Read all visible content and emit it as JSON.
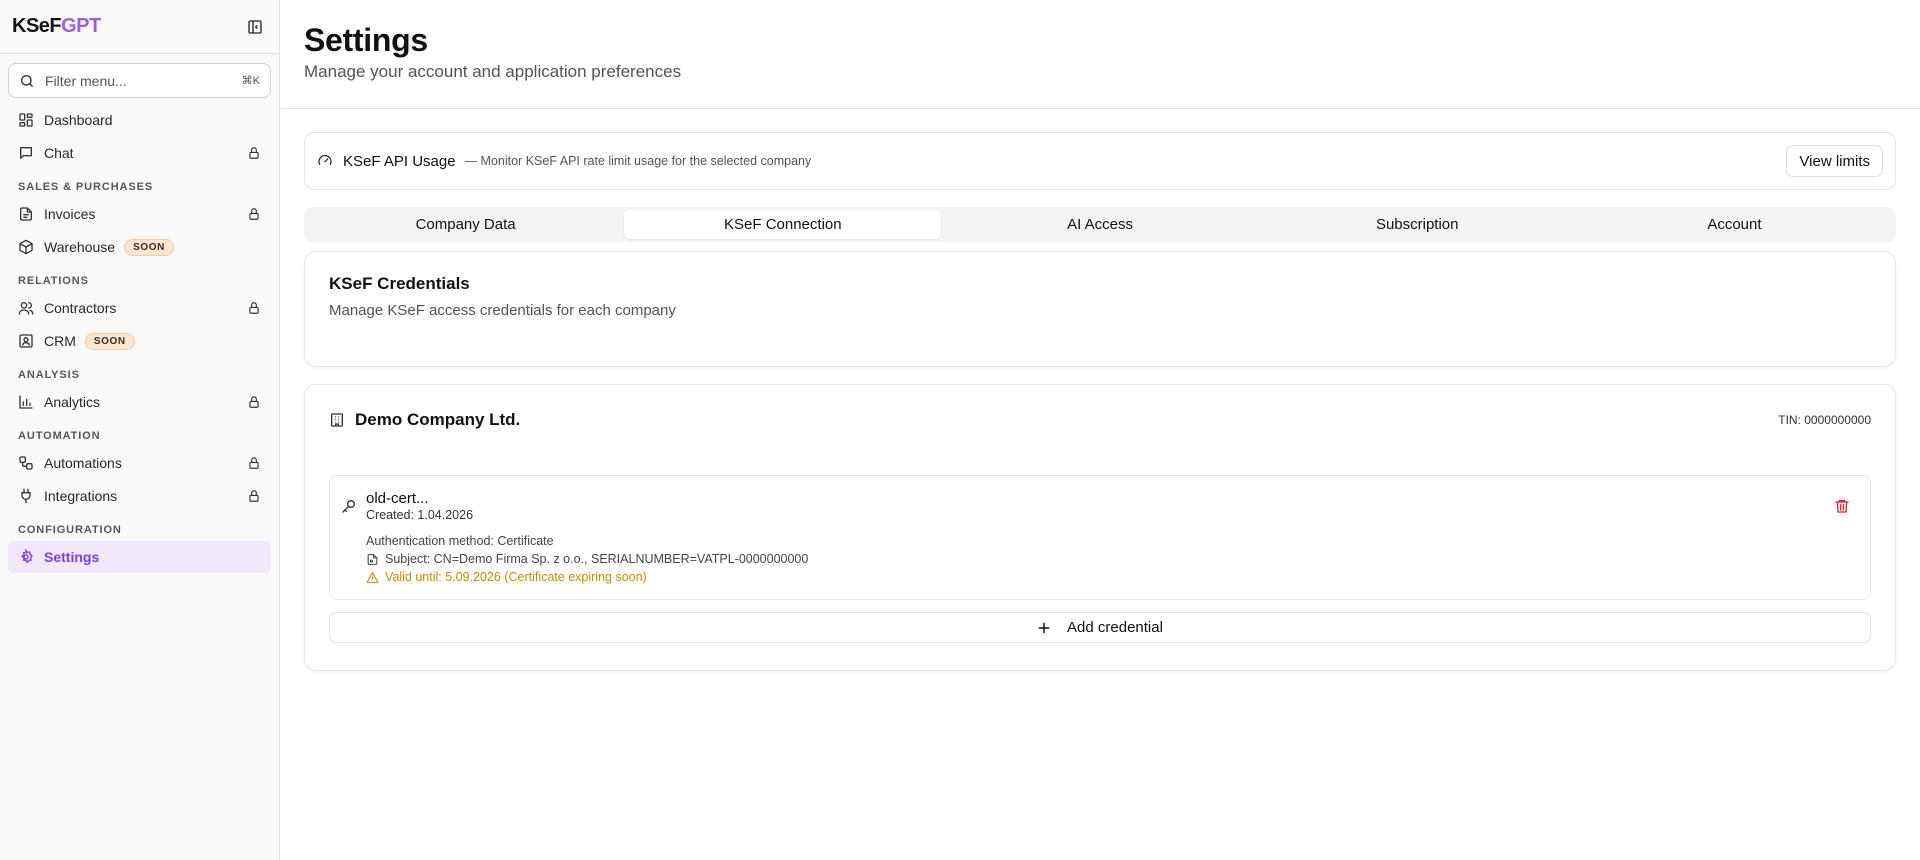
{
  "sidebar": {
    "brand_part1": "KSeF",
    "brand_part2": "GPT",
    "filter_placeholder": "Filter menu...",
    "filter_shortcut": "⌘K",
    "items_top": [
      {
        "label": "Dashboard",
        "icon": "dashboard-icon"
      },
      {
        "label": "Chat",
        "icon": "chat-icon",
        "locked": true
      }
    ],
    "sections": [
      {
        "label": "SALES & PURCHASES"
      },
      {
        "label": "RELATIONS"
      },
      {
        "label": "ANALYSIS"
      },
      {
        "label": "AUTOMATION"
      },
      {
        "label": "CONFIGURATION"
      }
    ],
    "items": {
      "invoices": "Invoices",
      "warehouse": "Warehouse",
      "contractors": "Contractors",
      "crm": "CRM",
      "analytics": "Analytics",
      "automations": "Automations",
      "integrations": "Integrations",
      "settings": "Settings"
    },
    "soon_badge": "SOON",
    "accent_color": "#7c3aed"
  },
  "header": {
    "title": "Settings",
    "subtitle": "Manage your account and application preferences"
  },
  "usage": {
    "title": "KSeF API Usage",
    "description": "— Monitor KSeF API rate limit usage for the selected company",
    "button": "View limits"
  },
  "tabs": [
    {
      "label": "Company Data",
      "active": false
    },
    {
      "label": "KSeF Connection",
      "active": true
    },
    {
      "label": "AI Access",
      "active": false
    },
    {
      "label": "Subscription",
      "active": false
    },
    {
      "label": "Account",
      "active": false
    }
  ],
  "credentials": {
    "title": "KSeF Credentials",
    "description": "Manage KSeF access credentials for each company"
  },
  "company": {
    "name": "Demo Company Ltd.",
    "tin": "TIN: 0000000000",
    "certificate": {
      "name": "old-cert...",
      "created": "Created: 1.04.2026",
      "auth_method": "Authentication method:  Certificate",
      "subject": "Subject: CN=Demo Firma Sp. z o.o., SERIALNUMBER=VATPL-0000000000",
      "valid_until": "Valid until: 5.09.2026 (Certificate expiring soon)",
      "warning_color": "#ca8a04",
      "delete_color": "#dc2626"
    },
    "add_button": "Add credential"
  }
}
